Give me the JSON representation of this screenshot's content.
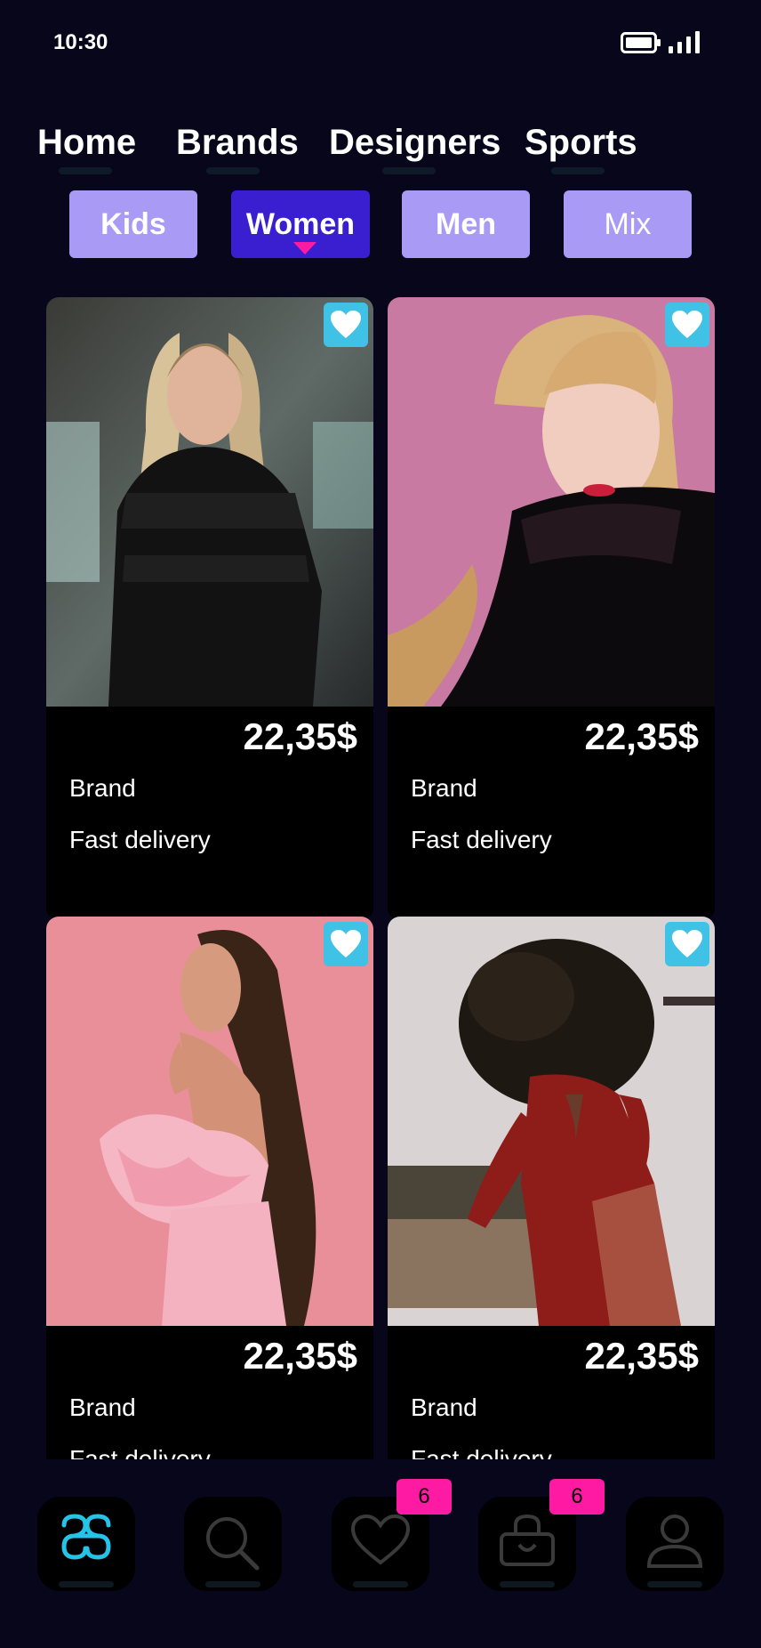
{
  "status_bar": {
    "time": "10:30",
    "battery_icon": "battery-full-icon",
    "signal_icon": "signal-bars-icon"
  },
  "top_nav": {
    "items": [
      {
        "label": "Home"
      },
      {
        "label": "Brands"
      },
      {
        "label": "Designers"
      },
      {
        "label": "Sports"
      }
    ]
  },
  "categories": {
    "selected": "Women",
    "items": [
      {
        "label": "Kids"
      },
      {
        "label": "Women"
      },
      {
        "label": "Men"
      },
      {
        "label": "Mix"
      }
    ]
  },
  "products": [
    {
      "price": "22,35$",
      "brand": "Brand",
      "delivery": "Fast delivery",
      "favorite_icon": "heart-icon"
    },
    {
      "price": "22,35$",
      "brand": "Brand",
      "delivery": "Fast delivery",
      "favorite_icon": "heart-icon"
    },
    {
      "price": "22,35$",
      "brand": "Brand",
      "delivery": "Fast delivery",
      "favorite_icon": "heart-icon"
    },
    {
      "price": "22,35$",
      "brand": "Brand",
      "delivery": "Fast delivery",
      "favorite_icon": "heart-icon"
    }
  ],
  "bottom_nav": {
    "items": [
      {
        "icon": "brand-logo-icon"
      },
      {
        "icon": "search-icon"
      },
      {
        "icon": "heart-icon",
        "badge": "6"
      },
      {
        "icon": "shopping-bag-icon",
        "badge": "6"
      },
      {
        "icon": "user-icon"
      }
    ]
  },
  "colors": {
    "background": "#07061a",
    "chip": "#a89af5",
    "chip_active": "#3a1fd0",
    "favorite": "#3fc2e6",
    "badge": "#ff1aa3",
    "accent": "#24c4e8"
  }
}
